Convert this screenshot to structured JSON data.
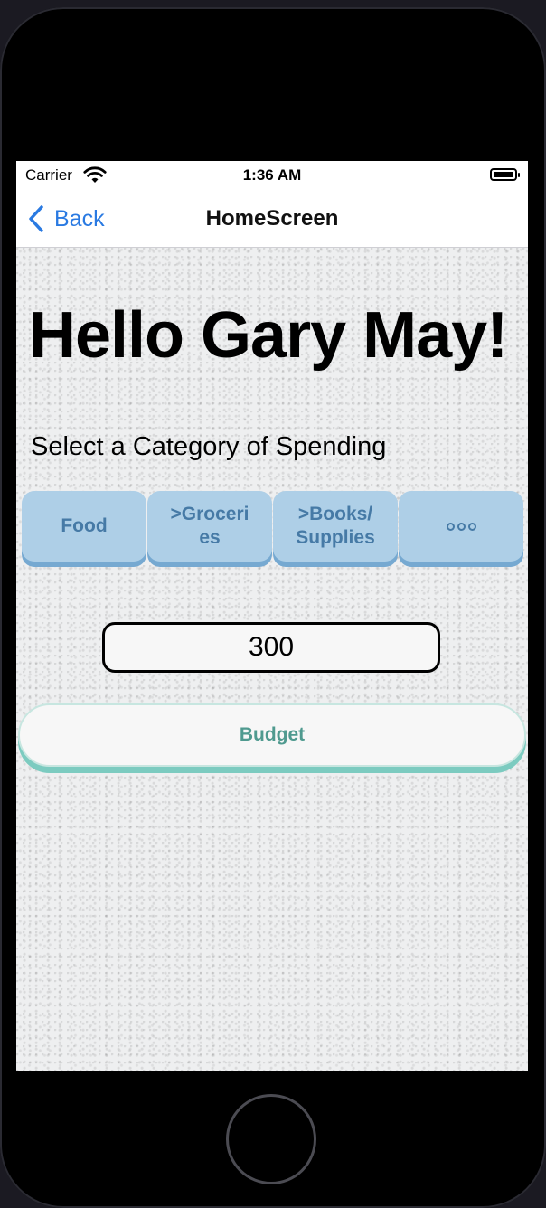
{
  "status_bar": {
    "carrier": "Carrier",
    "time": "1:36 AM"
  },
  "nav": {
    "back_label": "Back",
    "title": "HomeScreen"
  },
  "greeting": "Hello Gary May!",
  "prompt": "Select a Category of Spending",
  "categories": [
    {
      "label": "Food"
    },
    {
      "label": ">Groceri\nes"
    },
    {
      "label": ">Books/\nSupplies"
    },
    {
      "label": "",
      "icon": "more-dots-icon"
    }
  ],
  "amount_input": {
    "value": "300"
  },
  "budget_button": {
    "label": "Budget"
  },
  "colors": {
    "ios_blue": "#2a7ae2",
    "category_bg": "#aecfe7",
    "category_text": "#467aa6",
    "budget_text": "#4f9a8f",
    "budget_shadow": "#7ccbc0"
  }
}
